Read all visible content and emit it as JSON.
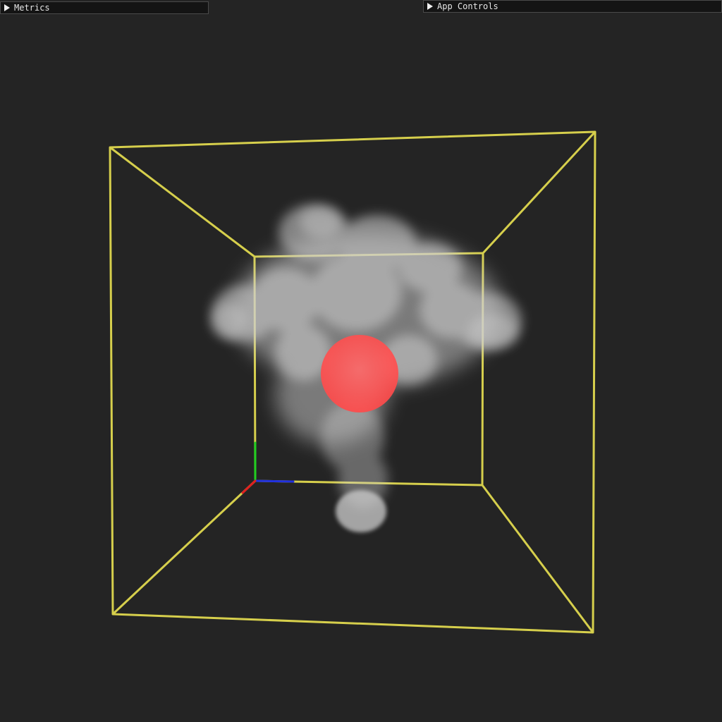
{
  "panels": {
    "metrics": {
      "title": "Metrics",
      "collapsed": true,
      "icon": "triangle-right-icon"
    },
    "app_controls": {
      "title": "App Controls",
      "collapsed": true,
      "icon": "triangle-right-icon"
    }
  },
  "colors": {
    "background": "#242424",
    "bounding_box": "#d6cf4c",
    "smoke": "#cfcfcf",
    "emitter_sphere": "#ff5a5a",
    "axis_x": "#e02020",
    "axis_y": "#20d020",
    "axis_z": "#2030e0"
  }
}
